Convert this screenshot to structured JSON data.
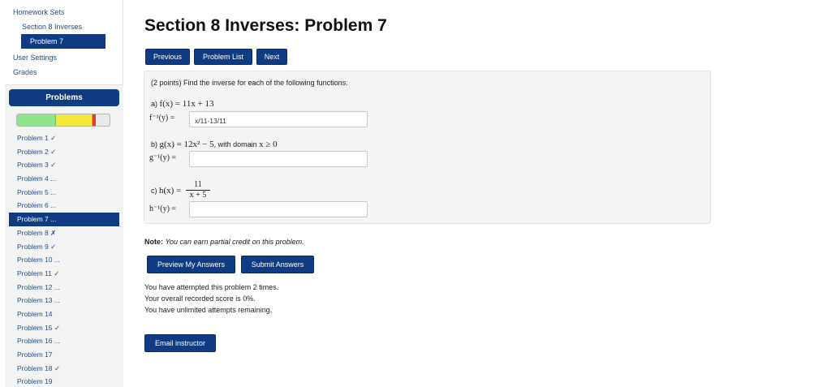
{
  "sidebar": {
    "homework_sets": "Homework Sets",
    "section": "Section 8 Inverses",
    "problem": "Problem 7",
    "user_settings": "User Settings",
    "grades": "Grades",
    "problems_title": "Problems",
    "progress": {
      "correct_fraction": 0.42,
      "partial_fraction": 0.4,
      "incorrect_fraction": 0.03
    },
    "problems": [
      {
        "label": "Problem 1 ✓",
        "active": false
      },
      {
        "label": "Problem 2 ✓",
        "active": false
      },
      {
        "label": "Problem 3 ✓",
        "active": false
      },
      {
        "label": "Problem 4 ...",
        "active": false
      },
      {
        "label": "Problem 5 ...",
        "active": false
      },
      {
        "label": "Problem 6 ...",
        "active": false
      },
      {
        "label": "Problem 7 ...",
        "active": true
      },
      {
        "label": "Problem 8 ✗",
        "active": false
      },
      {
        "label": "Problem 9 ✓",
        "active": false
      },
      {
        "label": "Problem 10 ...",
        "active": false
      },
      {
        "label": "Problem 11 ✓",
        "active": false
      },
      {
        "label": "Problem 12 ...",
        "active": false
      },
      {
        "label": "Problem 13 ...",
        "active": false
      },
      {
        "label": "Problem 14",
        "active": false
      },
      {
        "label": "Problem 15 ✓",
        "active": false
      },
      {
        "label": "Problem 16 ...",
        "active": false
      },
      {
        "label": "Problem 17",
        "active": false
      },
      {
        "label": "Problem 18 ✓",
        "active": false
      },
      {
        "label": "Problem 19",
        "active": false
      }
    ]
  },
  "main": {
    "title": "Section 8 Inverses: Problem 7",
    "nav": {
      "previous": "Previous",
      "problem_list": "Problem List",
      "next": "Next"
    },
    "intro": "(2 points) Find the inverse for each of the following functions.",
    "part_a": {
      "label": "a)",
      "func": "f(x) = 11x + 13",
      "inverse_label": "f⁻¹(y) =",
      "answer": "x/11-13/11"
    },
    "part_b": {
      "label": "b)",
      "func": "g(x) = 12x² − 5",
      "domain_text": ", with domain",
      "domain": "x ≥ 0",
      "inverse_label": "g⁻¹(y) =",
      "answer": ""
    },
    "part_c": {
      "label": "c)",
      "func": "h(x) =",
      "numerator": "11",
      "denominator": "x + 5",
      "inverse_label": "h⁻¹(y) =",
      "answer": ""
    },
    "note_label": "Note:",
    "note_text": "You can earn partial credit on this problem.",
    "preview_button": "Preview My Answers",
    "submit_button": "Submit Answers",
    "status_attempts": "You have attempted this problem 2 times.",
    "status_score": "Your overall recorded score is 0%.",
    "status_remaining": "You have unlimited attempts remaining.",
    "email_button": "Email instructor"
  },
  "colors": {
    "primary": "#0f3b82",
    "link": "#1f4e8c",
    "correct": "#8fe38b",
    "partial": "#f5e83a",
    "incorrect": "#e63b2e"
  }
}
